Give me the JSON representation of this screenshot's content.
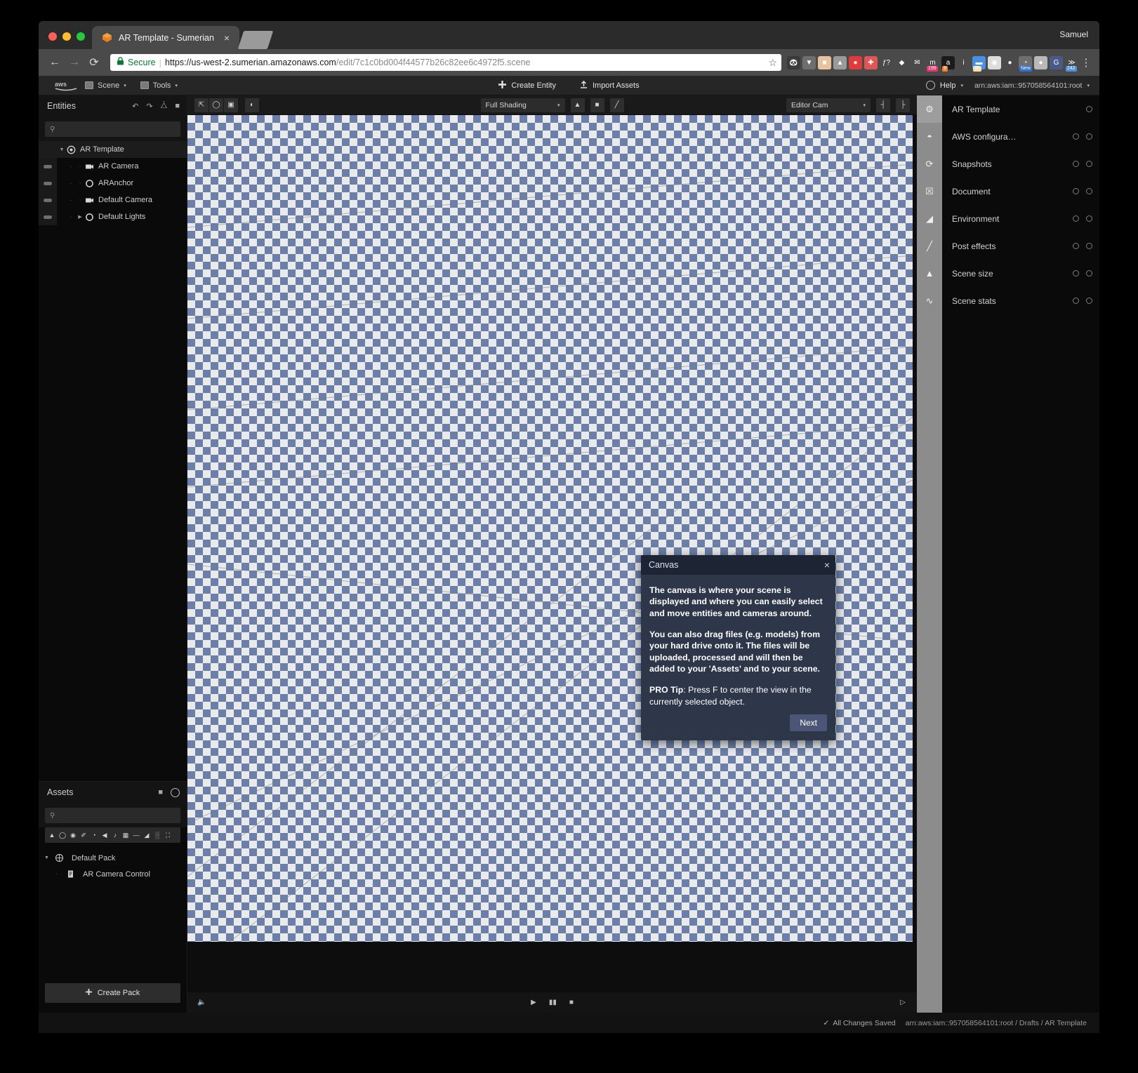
{
  "browser": {
    "profile_name": "Samuel",
    "tab": {
      "title": "AR Template - Sumerian",
      "favicon": "sumerian-cube-icon",
      "close": "×"
    },
    "nav": {
      "back": "←",
      "forward": "→",
      "reload": "⟳"
    },
    "omnibox": {
      "secure_label": "Secure",
      "separator": "|",
      "url_host": "https://us-west-2.sumerian.amazonaws.com",
      "url_path": "/edit/7c1c0bd004f44577b26c82ee6c4972f5.scene",
      "star": "☆"
    },
    "extensions": [
      {
        "name": "panda-extension-icon",
        "glyph": "🐼",
        "bg": "#3a3a3a",
        "badge": "",
        "badge_bg": ""
      },
      {
        "name": "pocket-extension-icon",
        "glyph": "▼",
        "bg": "#6e6e6e",
        "badge": "",
        "badge_bg": ""
      },
      {
        "name": "robot-extension-icon",
        "glyph": "■",
        "bg": "#e8c39e",
        "badge": "",
        "badge_bg": ""
      },
      {
        "name": "drive-extension-icon",
        "glyph": "▲",
        "bg": "#9a9a9a",
        "badge": "",
        "badge_bg": ""
      },
      {
        "name": "adblock-extension-icon",
        "glyph": "●",
        "bg": "#e03a3a",
        "badge": "",
        "badge_bg": ""
      },
      {
        "name": "cross-extension-icon",
        "glyph": "✚",
        "bg": "#e05555",
        "badge": "",
        "badge_bg": ""
      },
      {
        "name": "function-extension-icon",
        "glyph": "ƒ?",
        "bg": "transparent",
        "badge": "",
        "badge_bg": ""
      },
      {
        "name": "diamond-extension-icon",
        "glyph": "◆",
        "bg": "transparent",
        "badge": "",
        "badge_bg": ""
      },
      {
        "name": "mail-extension-icon",
        "glyph": "✉",
        "bg": "transparent",
        "badge": "",
        "badge_bg": ""
      },
      {
        "name": "momentum-extension-icon",
        "glyph": "m",
        "bg": "transparent",
        "badge": "199",
        "badge_bg": "#e8366f"
      },
      {
        "name": "amazon-extension-icon",
        "glyph": "a",
        "bg": "#1b1b1b",
        "badge": "9",
        "badge_bg": "#f08030"
      },
      {
        "name": "info-extension-icon",
        "glyph": "i",
        "bg": "transparent",
        "badge": "",
        "badge_bg": ""
      },
      {
        "name": "tabs-extension-icon",
        "glyph": "▬",
        "bg": "#4a8fe0",
        "badge": "3h",
        "badge_bg": "#efe0a8"
      },
      {
        "name": "camera-extension-icon",
        "glyph": "◉",
        "bg": "#dcdcdc",
        "badge": "",
        "badge_bg": ""
      },
      {
        "name": "evernote-extension-icon",
        "glyph": "●",
        "bg": "transparent",
        "badge": "",
        "badge_bg": ""
      },
      {
        "name": "colorpicker-extension-icon",
        "glyph": "◔",
        "bg": "#6f6f6f",
        "badge": "New",
        "badge_bg": "#2f6fd0"
      },
      {
        "name": "blob-extension-icon",
        "glyph": "●",
        "bg": "#b9b9b9",
        "badge": "",
        "badge_bg": ""
      },
      {
        "name": "google-extension-icon",
        "glyph": "G",
        "bg": "#4a5a86",
        "badge": "",
        "badge_bg": ""
      },
      {
        "name": "feedly-extension-icon",
        "glyph": "≫",
        "bg": "transparent",
        "badge": "242",
        "badge_bg": "#4a8fe0"
      }
    ],
    "menu_dots": "⋮"
  },
  "app": {
    "topbar": {
      "logo": "aws-logo",
      "menus": [
        {
          "name": "scene-menu",
          "label": "Scene",
          "icon": "grid-icon"
        },
        {
          "name": "tools-menu",
          "label": "Tools",
          "icon": "toolbox-icon"
        }
      ],
      "actions": [
        {
          "name": "create-entity-button",
          "label": "Create Entity",
          "icon": "plus-icon"
        },
        {
          "name": "import-assets-button",
          "label": "Import Assets",
          "icon": "upload-icon"
        }
      ],
      "help_label": "Help",
      "arn_label": "arn:aws:iam::957058564101:root"
    },
    "entities_panel": {
      "title": "Entities",
      "header_icons": [
        "undo-icon",
        "redo-icon",
        "duplicate-icon",
        "trash-icon"
      ],
      "search_placeholder": "",
      "search_value": "",
      "tree": [
        {
          "name": "entity-ar-template",
          "label": "AR Template",
          "icon": "scene-icon",
          "depth": 0,
          "expanded": true,
          "selected": true,
          "has_eye": false
        },
        {
          "name": "entity-ar-camera",
          "label": "AR Camera",
          "icon": "camera-icon",
          "depth": 1,
          "expanded": false,
          "selected": false,
          "has_eye": true
        },
        {
          "name": "entity-aranchor",
          "label": "ARAnchor",
          "icon": "entity-icon",
          "depth": 1,
          "expanded": false,
          "selected": false,
          "has_eye": true
        },
        {
          "name": "entity-default-camera",
          "label": "Default Camera",
          "icon": "camera-icon",
          "depth": 1,
          "expanded": false,
          "selected": false,
          "has_eye": true
        },
        {
          "name": "entity-default-lights",
          "label": "Default Lights",
          "icon": "entity-icon",
          "depth": 1,
          "expanded": false,
          "selected": false,
          "has_eye": true
        }
      ]
    },
    "assets_panel": {
      "title": "Assets",
      "header_icons": [
        "folder-icon",
        "help-circle-icon"
      ],
      "search_placeholder": "",
      "search_value": "",
      "toolbar_icons": [
        "geometry-icon",
        "sphere-icon",
        "material-icon",
        "script-icon",
        "sound-icon",
        "speaker-icon",
        "animation-icon",
        "texture-icon",
        "line-icon",
        "terrain-icon",
        "grid-icon",
        "expand-icon"
      ],
      "tree": [
        {
          "name": "asset-default-pack",
          "label": "Default Pack",
          "icon": "pack-icon",
          "depth": 0,
          "expanded": true
        },
        {
          "name": "asset-ar-camera-control",
          "label": "AR Camera Control",
          "icon": "script-icon",
          "depth": 1,
          "expanded": false
        }
      ],
      "create_pack_label": "Create Pack",
      "create_pack_icon": "plus-icon"
    },
    "canvas_toolbar": {
      "transform_tools": [
        {
          "name": "translate-tool",
          "icon": "cursor-icon"
        },
        {
          "name": "rotate-tool",
          "icon": "rotate-icon"
        },
        {
          "name": "scale-tool",
          "icon": "scale-icon"
        }
      ],
      "gizmo_tool": {
        "name": "gizmo-tool",
        "icon": "gizmo-icon"
      },
      "shading_select": {
        "name": "shading-select",
        "value": "Full Shading",
        "caret": "▾"
      },
      "shading_extra_icons": [
        "mountain-icon",
        "trash-icon",
        "pencil-icon"
      ],
      "camera_select": {
        "name": "camera-select",
        "value": "Editor Cam",
        "caret": "▾"
      },
      "camera_extra_icons": [
        "fit-left-icon",
        "fit-right-icon"
      ],
      "fullscreen_icon": "fullscreen-icon"
    },
    "statusline": {
      "left_icon": "speaker-mute-icon",
      "transport": [
        {
          "name": "play-button",
          "icon": "▶"
        },
        {
          "name": "pause-button",
          "icon": "▮▮"
        },
        {
          "name": "stop-button",
          "icon": "■"
        }
      ],
      "right_icon": "preview-play-icon"
    },
    "right_panel": {
      "sections": [
        {
          "name": "panel-ar-template",
          "label": "AR Template",
          "rail_icon": "gear-icon",
          "active": true,
          "icons": [
            "help-circle-icon"
          ]
        },
        {
          "name": "panel-aws-configuration",
          "label": "AWS configura…",
          "rail_icon": "cloud-icon",
          "active": false,
          "icons": [
            "eye-icon",
            "help-circle-icon"
          ]
        },
        {
          "name": "panel-snapshots",
          "label": "Snapshots",
          "rail_icon": "history-icon",
          "active": false,
          "icons": [
            "eye-icon",
            "help-circle-icon"
          ]
        },
        {
          "name": "panel-document",
          "label": "Document",
          "rail_icon": "document-icon",
          "active": false,
          "icons": [
            "eye-icon",
            "help-circle-icon"
          ]
        },
        {
          "name": "panel-environment",
          "label": "Environment",
          "rail_icon": "environment-icon",
          "active": false,
          "icons": [
            "eye-icon",
            "help-circle-icon"
          ]
        },
        {
          "name": "panel-post-effects",
          "label": "Post effects",
          "rail_icon": "wand-icon",
          "active": false,
          "icons": [
            "eye-icon",
            "help-circle-icon"
          ]
        },
        {
          "name": "panel-scene-size",
          "label": "Scene size",
          "rail_icon": "size-icon",
          "active": false,
          "icons": [
            "eye-icon",
            "help-circle-icon"
          ]
        },
        {
          "name": "panel-scene-stats",
          "label": "Scene stats",
          "rail_icon": "stats-icon",
          "active": false,
          "icons": [
            "eye-icon",
            "help-circle-icon"
          ]
        }
      ]
    },
    "footer": {
      "saved_status": "All Changes Saved",
      "saved_check": "✓",
      "breadcrumb": "arn:aws:iam::957058564101:root  /  Drafts  /  AR Template"
    }
  },
  "tour_dialog": {
    "title": "Canvas",
    "close_icon": "×",
    "paragraph_1": "The canvas is where your scene is displayed and where you can easily select and move entities and cameras around.",
    "paragraph_2": "You can also drag files (e.g. models) from your hard drive onto it. The files will be uploaded, processed and will then be added to your 'Assets' and to your scene.",
    "pro_tip_label": "PRO Tip",
    "pro_tip_text": ": Press F to center the view in the currently selected object.",
    "next_label": "Next"
  },
  "colors": {
    "checker_blue": "#6b7fa8",
    "checker_light": "#e9eaec",
    "dialog_bg": "#2e364a",
    "dialog_header": "#1d2434",
    "dialog_button": "#4b5676",
    "rail_bg": "#8c8c8c",
    "secure_green": "#0b7a35"
  }
}
